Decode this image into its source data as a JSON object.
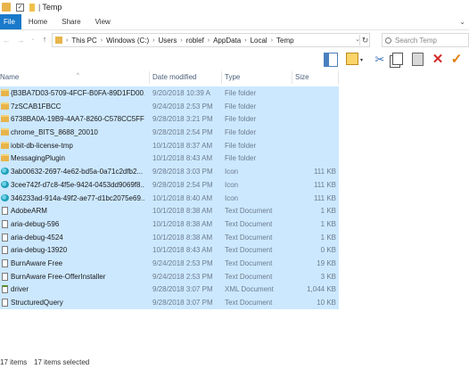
{
  "window": {
    "title": "Temp",
    "qat_separator": "|"
  },
  "ribbon": {
    "tabs": [
      "File",
      "Home",
      "Share",
      "View"
    ]
  },
  "address": {
    "crumbs": [
      "This PC",
      "Windows (C:)",
      "Users",
      "roblef",
      "AppData",
      "Local",
      "Temp"
    ],
    "search_placeholder": "Search Temp"
  },
  "columns": {
    "name": "Name",
    "date": "Date modified",
    "type": "Type",
    "size": "Size"
  },
  "files": [
    {
      "name": "{B3BA7D03-5709-4FCF-B0FA-89D1FD00...",
      "date": "9/20/2018 10:39 A",
      "type": "File folder",
      "size": "",
      "icon": "folder-icon"
    },
    {
      "name": "7zSCAB1FBCC",
      "date": "9/24/2018 2:53 PM",
      "type": "File folder",
      "size": "",
      "icon": "folder-icon"
    },
    {
      "name": "6738BA0A-19B9-4AA7-8260-C578CC5FF",
      "date": "9/28/2018 3:21 PM",
      "type": "File folder",
      "size": "",
      "icon": "folder-icon"
    },
    {
      "name": "chrome_BITS_8688_20010",
      "date": "9/28/2018 2:54 PM",
      "type": "File folder",
      "size": "",
      "icon": "folder-icon"
    },
    {
      "name": "iobit-db-license-tmp",
      "date": "10/1/2018 8:37 AM",
      "type": "File folder",
      "size": "",
      "icon": "folder-icon"
    },
    {
      "name": "MessagingPlugin",
      "date": "10/1/2018 8:43 AM",
      "type": "File folder",
      "size": "",
      "icon": "folder-icon"
    },
    {
      "name": "3ab00632-2697-4e62-bd5a-0a71c2dfb2...",
      "date": "9/28/2018 3:03 PM",
      "type": "Icon",
      "size": "111 KB",
      "icon": "image-icon"
    },
    {
      "name": "3cee742f-d7c8-4f5e-9424-0453dd9069f8...",
      "date": "9/28/2018 2:54 PM",
      "type": "Icon",
      "size": "111 KB",
      "icon": "image-icon"
    },
    {
      "name": "346233ad-914a-49f2-ae77-d1bc2075e69...",
      "date": "10/1/2018 8:40 AM",
      "type": "Icon",
      "size": "111 KB",
      "icon": "image-icon"
    },
    {
      "name": "AdobeARM",
      "date": "10/1/2018 8:38 AM",
      "type": "Text Document",
      "size": "1 KB",
      "icon": "text-file-icon"
    },
    {
      "name": "aria-debug-596",
      "date": "10/1/2018 8:38 AM",
      "type": "Text Document",
      "size": "1 KB",
      "icon": "text-file-icon"
    },
    {
      "name": "aria-debug-4524",
      "date": "10/1/2018 8:38 AM",
      "type": "Text Document",
      "size": "1 KB",
      "icon": "text-file-icon"
    },
    {
      "name": "aria-debug-13920",
      "date": "10/1/2018 8:43 AM",
      "type": "Text Document",
      "size": "0 KB",
      "icon": "text-file-icon"
    },
    {
      "name": "BurnAware Free",
      "date": "9/24/2018 2:53 PM",
      "type": "Text Document",
      "size": "19 KB",
      "icon": "text-file-icon"
    },
    {
      "name": "BurnAware Free-OfferInstaller",
      "date": "9/24/2018 2:53 PM",
      "type": "Text Document",
      "size": "3 KB",
      "icon": "text-file-icon"
    },
    {
      "name": "driver",
      "date": "9/28/2018 3:07 PM",
      "type": "XML Document",
      "size": "1,044 KB",
      "icon": "xml-file-icon"
    },
    {
      "name": "StructuredQuery",
      "date": "9/28/2018 3:07 PM",
      "type": "Text Document",
      "size": "10 KB",
      "icon": "text-file-icon"
    }
  ],
  "status": {
    "item_count": "17 items",
    "selected": "17 items selected"
  },
  "colors": {
    "selection": "#cce8ff",
    "file_tab": "#1979ca",
    "delete": "#d22a2a",
    "check": "#e07b00"
  }
}
